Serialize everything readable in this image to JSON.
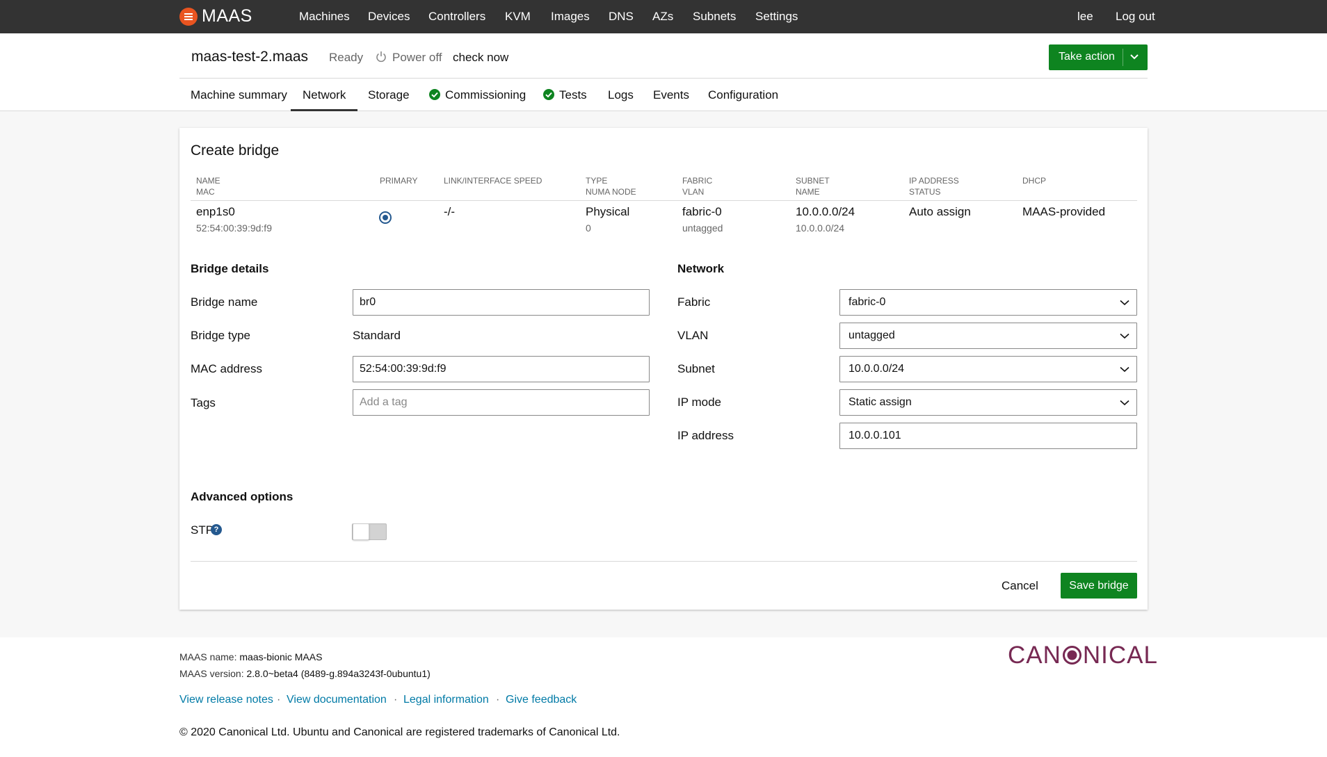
{
  "app": {
    "name": "MAAS"
  },
  "nav": {
    "items": [
      "Machines",
      "Devices",
      "Controllers",
      "KVM",
      "Images",
      "DNS",
      "AZs",
      "Subnets",
      "Settings"
    ],
    "user": "lee",
    "logout": "Log out"
  },
  "machine": {
    "hostname": "maas-test-2.maas",
    "status": "Ready",
    "power": "Power off",
    "check_now": "check now",
    "take_action": "Take action"
  },
  "tabs": [
    {
      "label": "Machine summary",
      "active": false,
      "check": false
    },
    {
      "label": "Network",
      "active": true,
      "check": false
    },
    {
      "label": "Storage",
      "active": false,
      "check": false
    },
    {
      "label": "Commissioning",
      "active": false,
      "check": true
    },
    {
      "label": "Tests",
      "active": false,
      "check": true
    },
    {
      "label": "Logs",
      "active": false,
      "check": false
    },
    {
      "label": "Events",
      "active": false,
      "check": false
    },
    {
      "label": "Configuration",
      "active": false,
      "check": false
    }
  ],
  "form": {
    "title": "Create bridge",
    "table": {
      "headers": [
        [
          "NAME",
          "MAC"
        ],
        [
          "PRIMARY",
          ""
        ],
        [
          "LINK/INTERFACE SPEED",
          ""
        ],
        [
          "TYPE",
          "NUMA NODE"
        ],
        [
          "FABRIC",
          "VLAN"
        ],
        [
          "SUBNET",
          "NAME"
        ],
        [
          "IP ADDRESS",
          "STATUS"
        ],
        [
          "DHCP",
          ""
        ]
      ],
      "row": {
        "name": "enp1s0",
        "mac": "52:54:00:39:9d:f9",
        "speed": "-/-",
        "type": "Physical",
        "numa": "0",
        "fabric": "fabric-0",
        "vlan": "untagged",
        "subnet": "10.0.0.0/24",
        "subnet_name": "10.0.0.0/24",
        "ip": "Auto assign",
        "dhcp": "MAAS-provided"
      }
    },
    "bridge": {
      "section": "Bridge details",
      "name_label": "Bridge name",
      "name_value": "br0",
      "type_label": "Bridge type",
      "type_value": "Standard",
      "mac_label": "MAC address",
      "mac_value": "52:54:00:39:9d:f9",
      "tags_label": "Tags",
      "tags_placeholder": "Add a tag"
    },
    "network": {
      "section": "Network",
      "fabric_label": "Fabric",
      "fabric_value": "fabric-0",
      "vlan_label": "VLAN",
      "vlan_value": "untagged",
      "subnet_label": "Subnet",
      "subnet_value": "10.0.0.0/24",
      "ipmode_label": "IP mode",
      "ipmode_value": "Static assign",
      "ip_label": "IP address",
      "ip_value": "10.0.0.101"
    },
    "advanced": {
      "section": "Advanced options",
      "stp_label": "STP",
      "stp_help": "?",
      "stp_enabled": false
    },
    "cancel": "Cancel",
    "save": "Save bridge"
  },
  "footer": {
    "maas_name_label": "MAAS name:",
    "maas_name": "maas-bionic MAAS",
    "maas_version_label": "MAAS version:",
    "maas_version": "2.8.0~beta4 (8489-g.894a3243f-0ubuntu1)",
    "links": [
      "View release notes",
      "View documentation",
      "Legal information",
      "Give feedback"
    ],
    "separator": "·",
    "copyright": "© 2020 Canonical Ltd. Ubuntu and Canonical are registered trademarks of Canonical Ltd.",
    "brand": "CANONICAL"
  },
  "colors": {
    "nav_bg": "#333333",
    "brand_orange": "#e95420",
    "positive": "#0e8420",
    "link": "#007aa6",
    "canonical": "#772953"
  }
}
